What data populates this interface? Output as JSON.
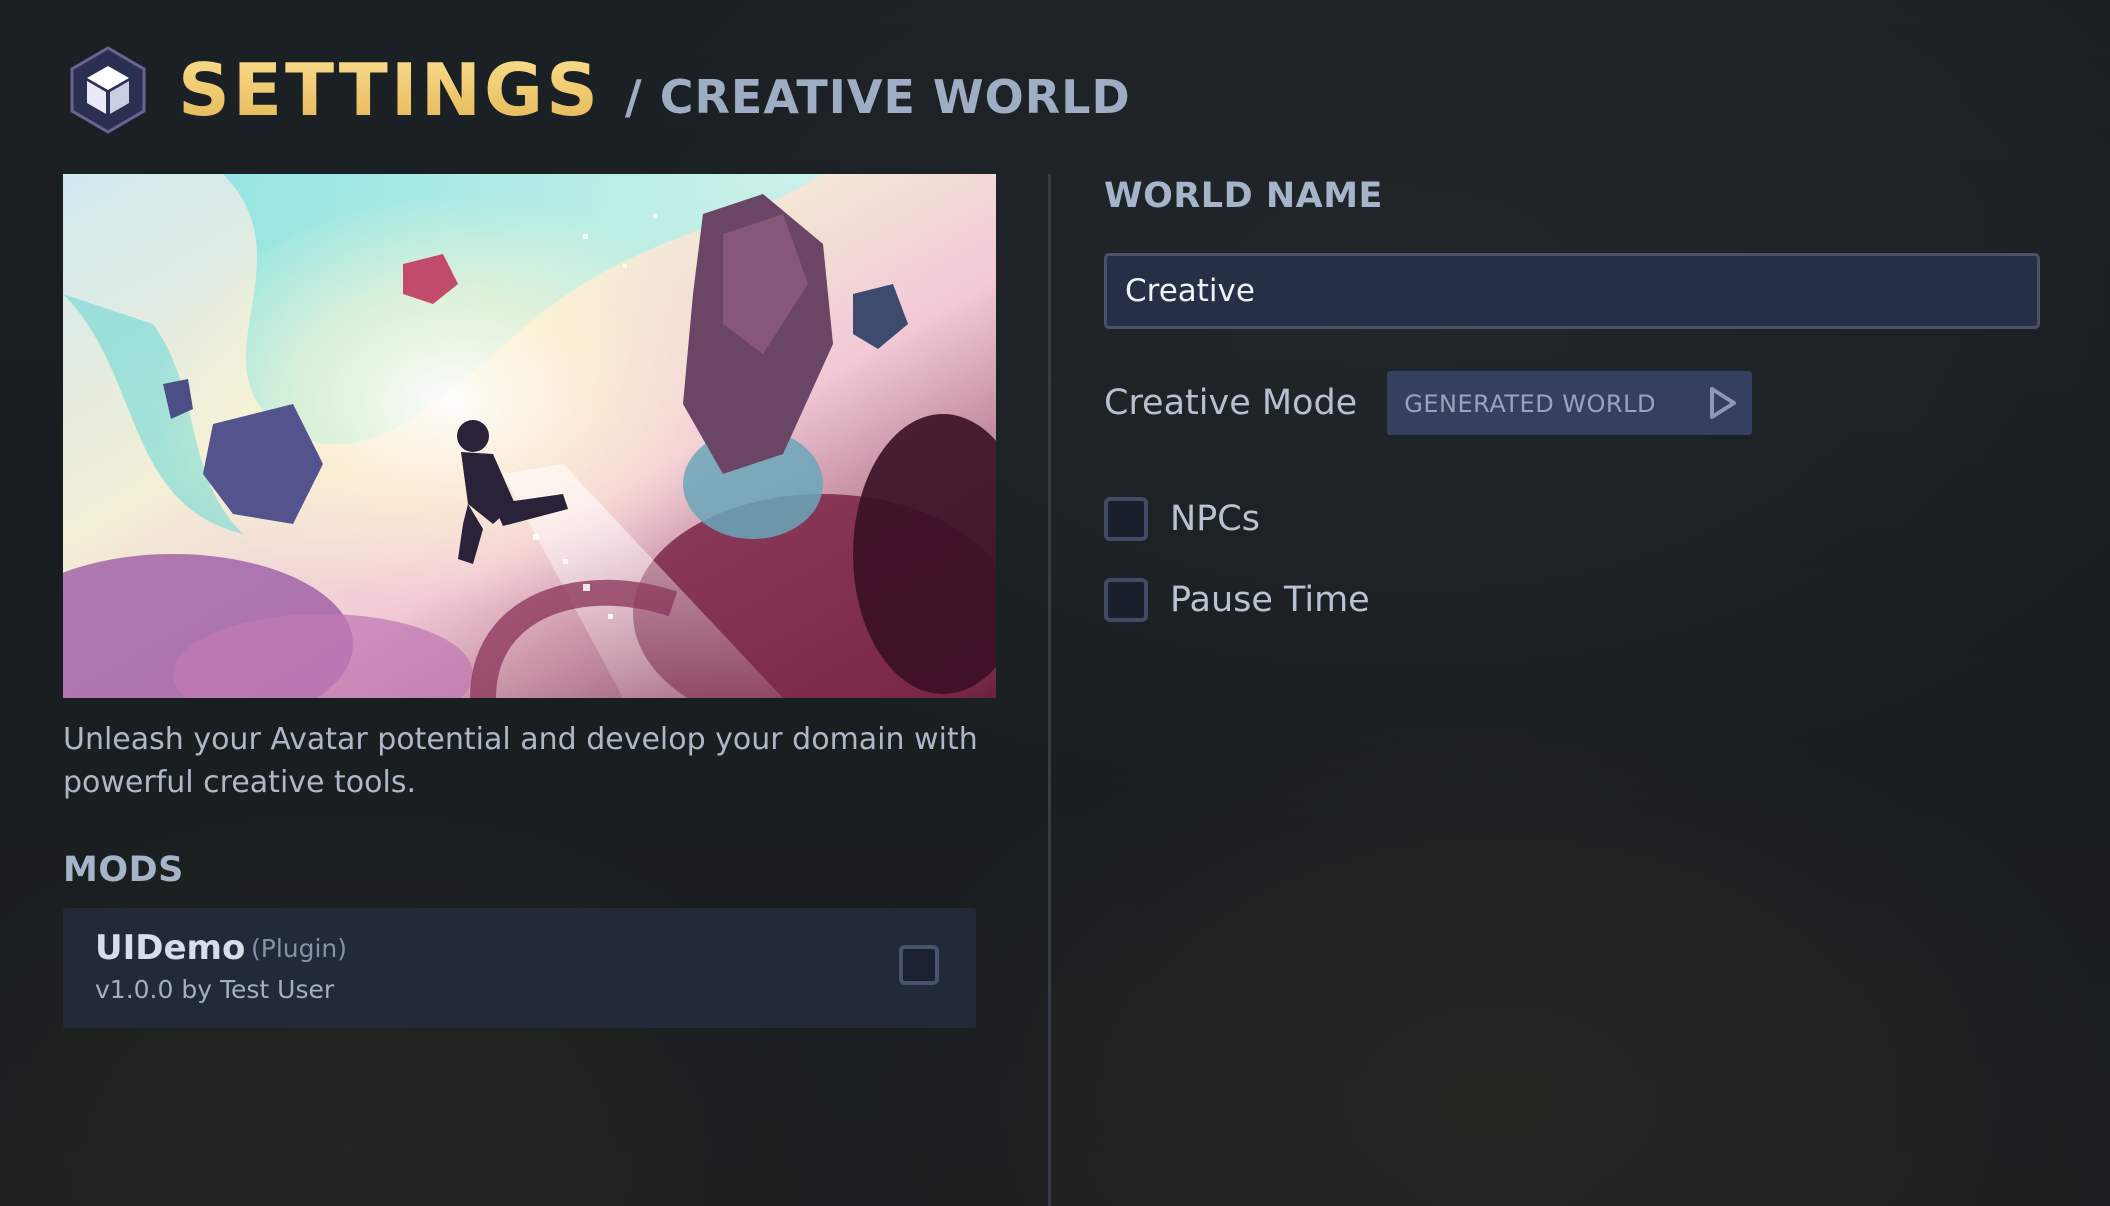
{
  "header": {
    "title": "SETTINGS",
    "subtitle": "/ CREATIVE WORLD",
    "logo_icon": "cube-icon"
  },
  "hero": {
    "image_name": "creative-world-artwork"
  },
  "description": "Unleash your Avatar potential and develop your domain with powerful creative tools.",
  "mods": {
    "label": "MODS",
    "items": [
      {
        "name": "UIDemo",
        "type": "(Plugin)",
        "version": "v1.0.0 by Test User",
        "checked": false
      }
    ]
  },
  "world": {
    "label": "WORLD NAME",
    "name_value": "Creative"
  },
  "creative_mode": {
    "label": "Creative Mode",
    "selected": "GENERATED WORLD",
    "arrow_icon": "play-arrow-icon"
  },
  "options": [
    {
      "label": "NPCs",
      "checked": false
    },
    {
      "label": "Pause Time",
      "checked": false
    }
  ],
  "colors": {
    "title_gold": "#f1cd72",
    "label_blue_gray": "#a6b3c8",
    "panel": "#222a38",
    "input_bg": "#272f47",
    "select_bg": "#34405e"
  }
}
